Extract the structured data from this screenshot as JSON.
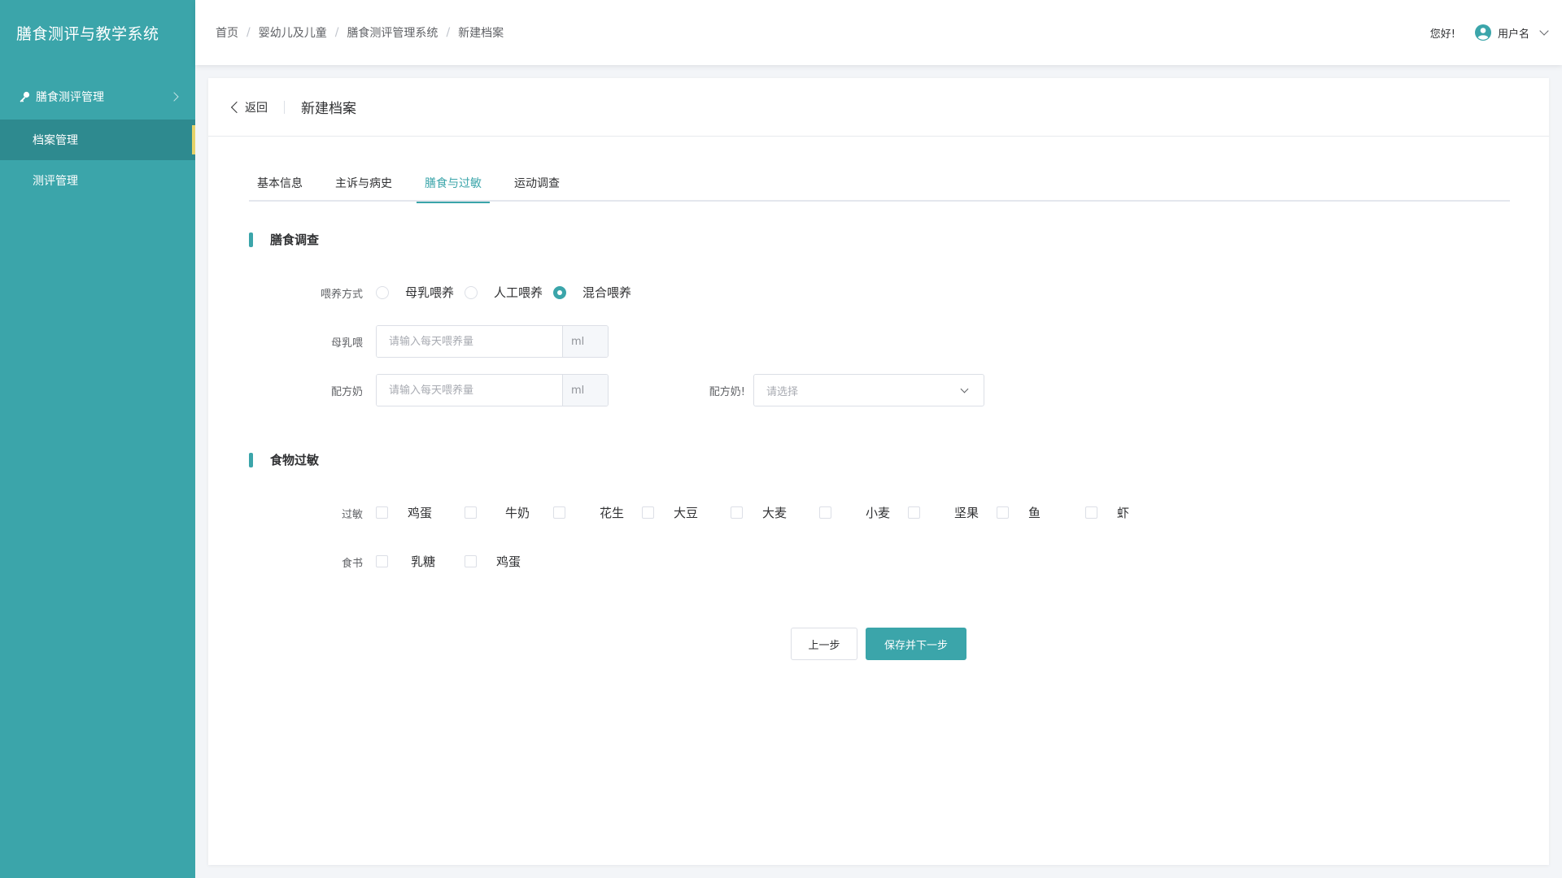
{
  "app": {
    "title": "膳食测评与教学系统"
  },
  "sidebar": {
    "group": {
      "label": "膳食测评管理",
      "icon": "key-icon"
    },
    "items": [
      {
        "label": "档案管理",
        "active": true
      },
      {
        "label": "测评管理",
        "active": false
      }
    ]
  },
  "header": {
    "breadcrumb": [
      "首页",
      "婴幼儿及儿童",
      "膳食测评管理系统",
      "新建档案"
    ],
    "greeting": "您好!",
    "username": "用户名"
  },
  "card": {
    "back_label": "返回",
    "title": "新建档案",
    "tabs": [
      {
        "label": "基本信息",
        "active": false
      },
      {
        "label": "主诉与病史",
        "active": false
      },
      {
        "label": "膳食与过敏",
        "active": true
      },
      {
        "label": "运动调查",
        "active": false
      }
    ]
  },
  "diet": {
    "section_title": "膳食调查",
    "feeding_label": "喂养方式",
    "feeding_options": [
      {
        "label": "母乳喂养",
        "checked": false
      },
      {
        "label": "人工喂养",
        "checked": false
      },
      {
        "label": "混合喂养",
        "checked": true
      }
    ],
    "breast_label": "母乳喂",
    "breast_placeholder": "请输入每天喂养量",
    "breast_unit": "ml",
    "formula_label": "配方奶",
    "formula_placeholder": "请输入每天喂养量",
    "formula_unit": "ml",
    "formula_type_label": "配方奶!",
    "formula_type_placeholder": "请选择"
  },
  "allergy": {
    "section_title": "食物过敏",
    "allergy_label": "过敏",
    "allergy_items": [
      "鸡蛋",
      "牛奶",
      "花生",
      "大豆",
      "大麦",
      "小麦",
      "坚果",
      "鱼",
      "虾"
    ],
    "intolerance_label": "食书",
    "intolerance_items": [
      "乳糖",
      "鸡蛋"
    ]
  },
  "footer": {
    "prev_label": "上一步",
    "next_label": "保存并下一步"
  },
  "colors": {
    "accent": "#3ba5aa",
    "sidebar_active": "#2e8a8f",
    "indicator": "#e6d36a"
  }
}
